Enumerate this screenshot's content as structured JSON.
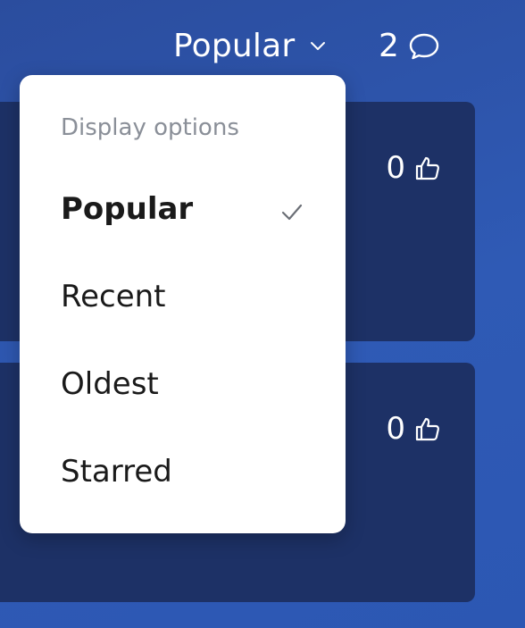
{
  "header": {
    "sort_label": "Popular",
    "comments_count": "2",
    "icons": {
      "sort_chevron": "chevron-down-icon",
      "comments": "speech-bubble-icon"
    }
  },
  "cards": [
    {
      "likes": "0",
      "icon": "thumbs-up-icon"
    },
    {
      "likes": "0",
      "icon": "thumbs-up-icon"
    }
  ],
  "dropdown": {
    "header": "Display options",
    "items": [
      {
        "label": "Popular",
        "selected": true
      },
      {
        "label": "Recent",
        "selected": false
      },
      {
        "label": "Oldest",
        "selected": false
      },
      {
        "label": "Starred",
        "selected": false
      }
    ],
    "selected_icon": "checkmark-icon"
  },
  "colors": {
    "background": "#2f5ab5",
    "card": "#1d3166",
    "menu_bg": "#ffffff",
    "menu_header": "#8a8f98",
    "checkmark": "#6b6f76"
  }
}
